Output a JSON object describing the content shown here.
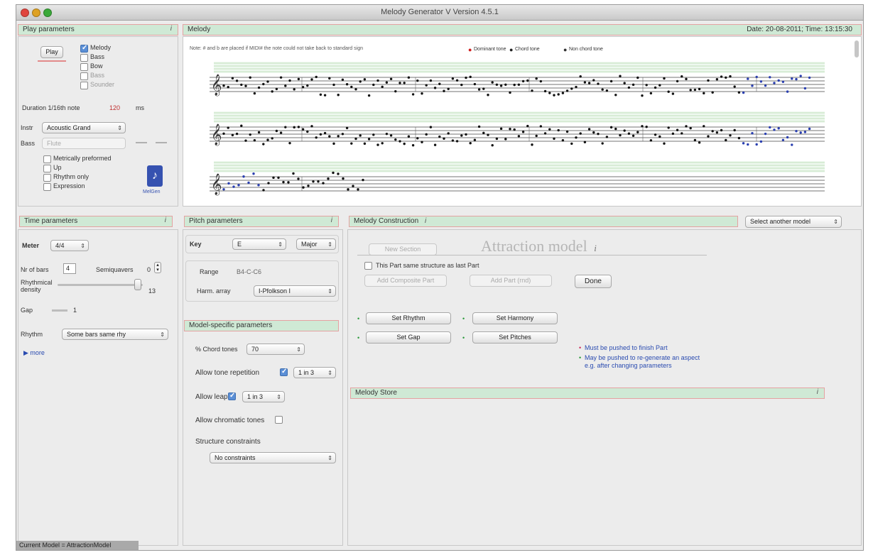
{
  "window": {
    "title": "Melody Generator V Version 4.5.1",
    "traffic_colors": [
      "#e0443e",
      "#dea123",
      "#3ba93a"
    ]
  },
  "play": {
    "header": "Play parameters",
    "play_label": "Play",
    "voices": [
      {
        "label": "Melody",
        "checked": true
      },
      {
        "label": "Bass",
        "checked": false
      },
      {
        "label": "Bow",
        "checked": false
      },
      {
        "label": "Bass",
        "checked": false
      },
      {
        "label": "Sounder",
        "checked": false
      }
    ],
    "duration_label": "Duration 1/16th note",
    "duration_value": "120",
    "duration_unit": "ms",
    "instrument_label": "Instr",
    "instrument_value": "Acoustic Grand",
    "bass_label": "Bass",
    "bass_value": "Flute",
    "options": [
      {
        "label": "Metrically preformed",
        "checked": false
      },
      {
        "label": "Up",
        "checked": false
      },
      {
        "label": "Rhythm only",
        "checked": false
      },
      {
        "label": "Expression",
        "checked": false
      }
    ],
    "logo_caption": "MelGen"
  },
  "melody": {
    "header": "Melody",
    "date_text": "Date: 20-08-2011; Time: 13:15:30",
    "note_text": "Note: # and b are placed if MIDI# the note could not take back to standard sign",
    "legend": [
      {
        "label": "Dominant tone",
        "color": "#d02020"
      },
      {
        "label": "Chord tone",
        "color": "#222222"
      },
      {
        "label": "Non chord tone",
        "color": "#333333"
      }
    ],
    "green_color": "#98c88a",
    "dot_color": "#111111",
    "blue_dot_color": "#2a3fb0"
  },
  "time": {
    "header": "Time parameters",
    "meter_label": "Meter",
    "meter_value": "4/4",
    "bars_label": "Nr of bars",
    "bars_value": "4",
    "semiquaver_label": "Semiquavers",
    "semiquaver_value": "0",
    "density_label": "Rhythmical density",
    "density_value": "13",
    "gap_label": "Gap",
    "gap_value": "1",
    "rhythm_label": "Rhythm",
    "rhythm_value": "Some bars same rhy",
    "more_label": "▶ more"
  },
  "pitch": {
    "header": "Pitch parameters",
    "key_label": "Key",
    "key_value": "E",
    "mode_value": "Major",
    "range_label": "Range",
    "range_value": "B4-C-C6",
    "harm_label": "Harm. array",
    "harm_value": "I-Pfolkson I"
  },
  "model_specific": {
    "header": "Model-specific parameters",
    "chord_tones_label": "% Chord tones",
    "chord_tones_value": "70",
    "repetition_label": "Allow tone repetition",
    "repetition_checked": true,
    "repetition_value": "1 in 3",
    "leap_label": "Allow leap",
    "leap_checked": true,
    "leap_value": "1 in 3",
    "chromatic_label": "Allow chromatic tones",
    "chromatic_checked": false,
    "structure_label": "Structure constraints",
    "structure_value": "No constraints"
  },
  "construction": {
    "header": "Melody Construction",
    "select_model": "Select another model",
    "model_title": "Attraction model",
    "new_section": "New Section",
    "same_structure_label": "This Part same structure as last Part",
    "add_composite": "Add Composite Part",
    "add_part": "Add Part (rnd)",
    "done": "Done",
    "set_rhythm": "Set Rhythm",
    "set_harmony": "Set Harmony",
    "set_gap": "Set Gap",
    "set_pitches": "Set Pitches",
    "legend1": "Must be pushed to finish Part",
    "legend1_color": "#cc2a5a",
    "legend2": "May be pushed to re-generate an aspect e.g. after changing parameters",
    "legend2_color": "#2a9a3a",
    "link_color": "#2a4bb0"
  },
  "store": {
    "header": "Melody Store"
  },
  "status": "Current Model = AttractionModel"
}
